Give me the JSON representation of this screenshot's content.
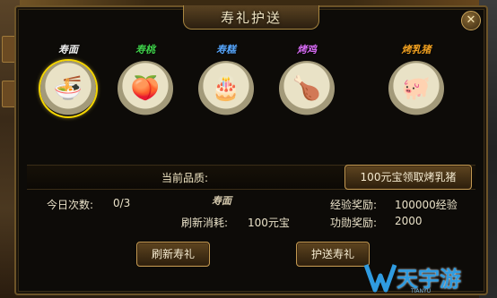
{
  "window": {
    "title": "寿礼护送",
    "close_label": "✕"
  },
  "gifts": [
    {
      "name": "寿面",
      "name_color": "#f0f0f0",
      "food": "🍜",
      "selected": true
    },
    {
      "name": "寿桃",
      "name_color": "#3fd24a",
      "food": "🍑",
      "selected": false
    },
    {
      "name": "寿糕",
      "name_color": "#58a8ff",
      "food": "🎂",
      "selected": false
    },
    {
      "name": "烤鸡",
      "name_color": "#d46af0",
      "food": "🍗",
      "selected": false
    },
    {
      "name": "烤乳猪",
      "name_color": "#f0a020",
      "food": "🐖",
      "selected": false
    }
  ],
  "quality": {
    "label": "当前品质:",
    "buy_button": "100元宝领取烤乳猪"
  },
  "stats": {
    "daily_label": "今日次数:",
    "daily_value": "0/3",
    "current_gift_name": "寿面",
    "refresh_cost_label": "刷新消耗:",
    "refresh_cost_value": "100元宝",
    "exp_reward_label": "经验奖励:",
    "exp_reward_value": "100000经验",
    "merit_reward_label": "功勋奖励:",
    "merit_reward_value": "2000"
  },
  "buttons": {
    "refresh": "刷新寿礼",
    "escort": "护送寿礼"
  },
  "watermark": {
    "text": "天宇游",
    "sub": "TIANYU"
  }
}
